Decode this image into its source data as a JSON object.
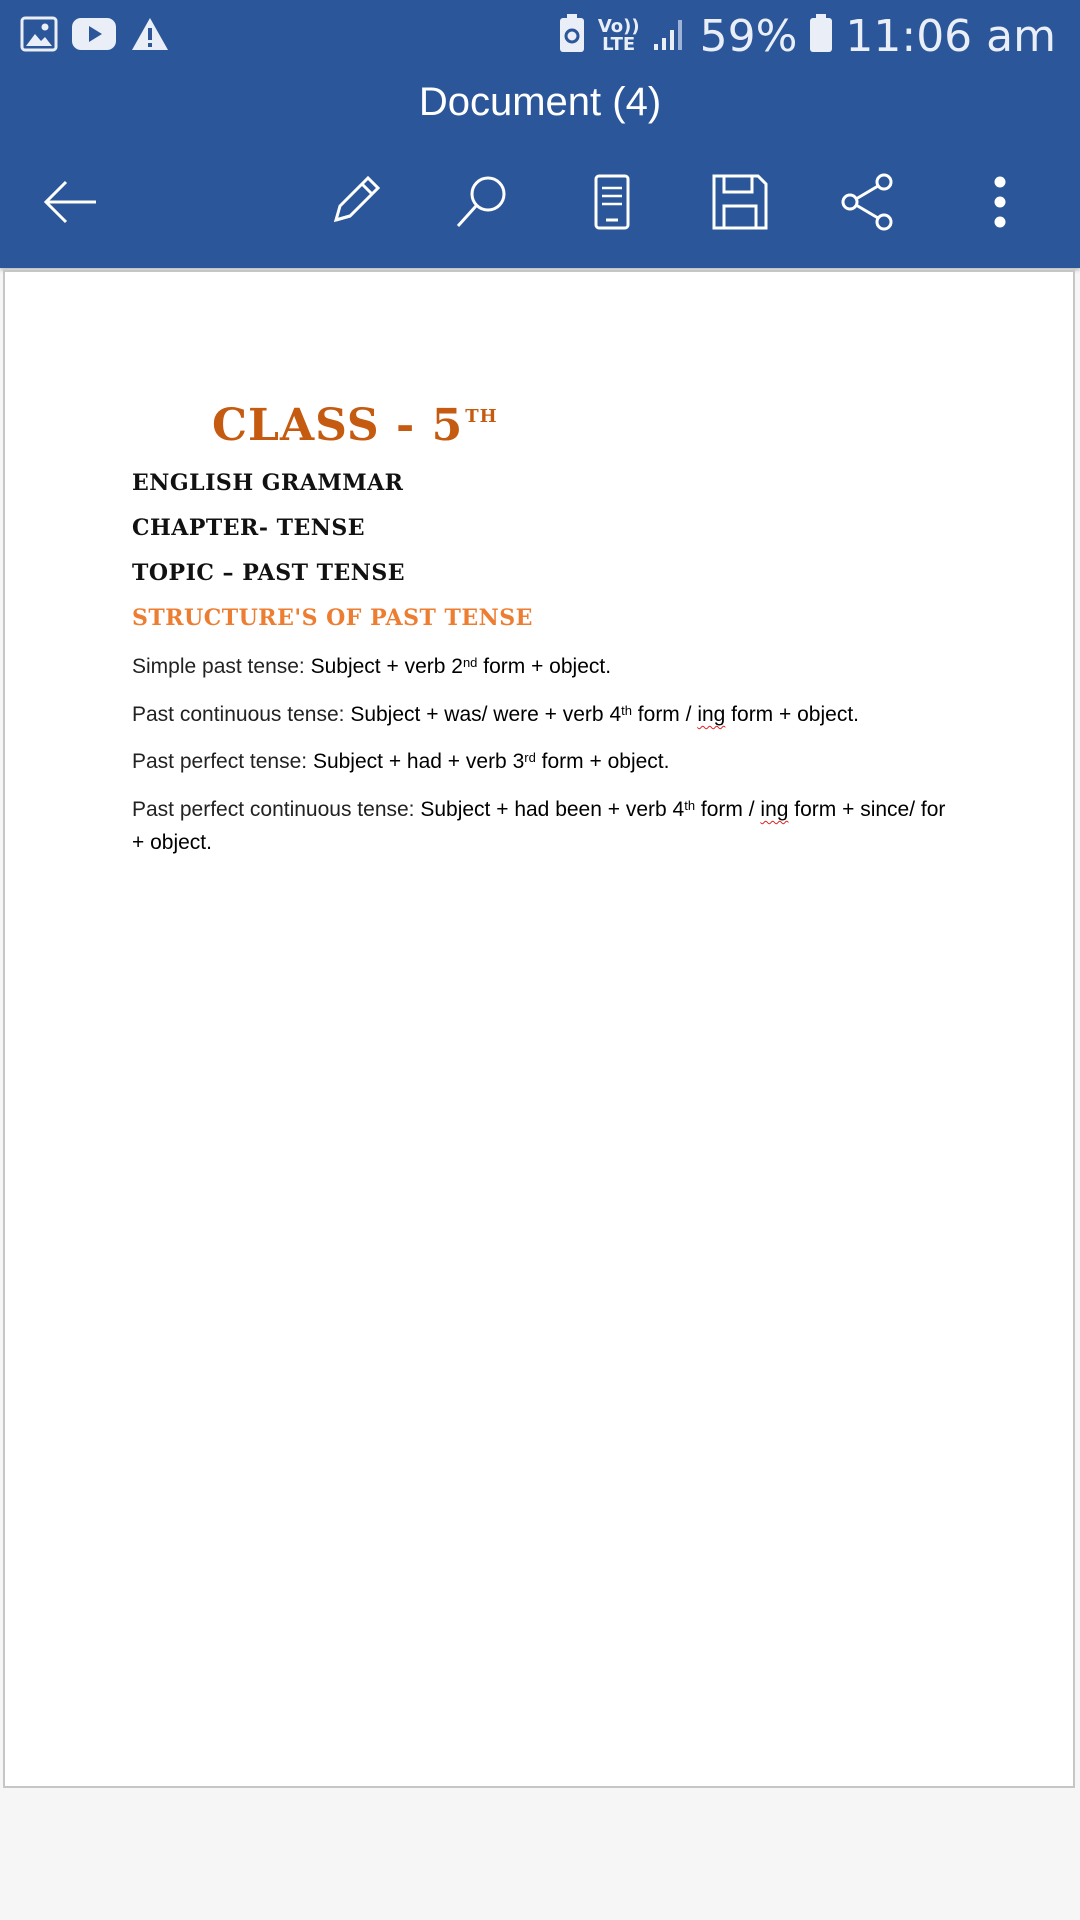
{
  "status_bar": {
    "battery_percent": "59%",
    "time": "11:06 am",
    "network_top": "Vo))",
    "network_bottom": "LTE",
    "icons": [
      "gallery-icon",
      "youtube-icon",
      "warning-icon",
      "battery-saver-icon",
      "signal-icon",
      "battery-icon"
    ]
  },
  "app_bar": {
    "title": "Document (4)",
    "actions": [
      "back-icon",
      "edit-icon",
      "search-icon",
      "mobile-view-icon",
      "save-icon",
      "share-icon",
      "more-icon"
    ],
    "color": "#2b579a"
  },
  "document": {
    "heading": "CLASS - 5",
    "heading_sup": "TH",
    "subject": "ENGLISH GRAMMAR",
    "chapter": "CHAPTER- TENSE",
    "topic": "TOPIC – PAST TENSE",
    "structures_title": "STRUCTURE'S OF PAST TENSE",
    "lines": [
      {
        "label": "Simple past tense: ",
        "pre": "Subject + verb 2",
        "sup": "nd",
        "post": " form + object."
      },
      {
        "label": "Past continuous tense: ",
        "pre": "Subject + was/ were + verb 4",
        "sup": "th",
        "mid": " form / ",
        "squig": "ing",
        "post": " form + object."
      },
      {
        "label": "Past perfect tense: ",
        "pre": "Subject + had + verb 3",
        "sup": "rd",
        "post": "  form + object."
      },
      {
        "label": "Past perfect continuous tense: ",
        "pre": "Subject + had been + verb 4",
        "sup": "th",
        "mid": " form / ",
        "squig": "ing",
        "post": " form + since/ for + object."
      }
    ],
    "accent_color": "#c55a11",
    "orange_color": "#ed7d31"
  }
}
